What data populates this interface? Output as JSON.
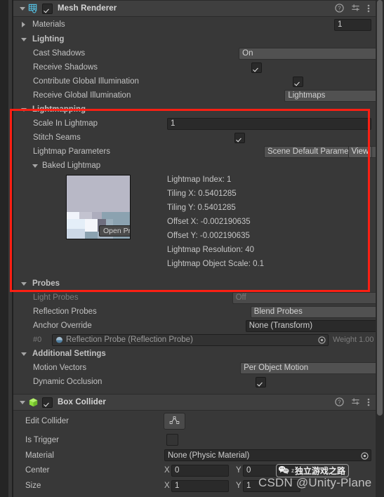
{
  "mesh_renderer": {
    "title": "Mesh Renderer",
    "enabled": true,
    "icon": "mesh-renderer-icon",
    "header_icons": [
      "help-icon",
      "preset-icon",
      "more-menu-icon"
    ],
    "materials": {
      "label": "Materials",
      "count": "1"
    },
    "lighting": {
      "label": "Lighting",
      "rows": [
        {
          "label": "Cast Shadows",
          "type": "dropdown",
          "value": "On"
        },
        {
          "label": "Receive Shadows",
          "type": "checkbox",
          "value": true
        },
        {
          "label": "Contribute Global Illumination",
          "type": "checkbox",
          "value": true
        },
        {
          "label": "Receive Global Illumination",
          "type": "dropdown",
          "value": "Lightmaps"
        }
      ]
    },
    "lightmapping": {
      "label": "Lightmapping",
      "scale_in_lightmap": {
        "label": "Scale In Lightmap",
        "value": "1"
      },
      "stitch_seams": {
        "label": "Stitch Seams",
        "value": true
      },
      "lightmap_parameters": {
        "label": "Lightmap Parameters",
        "value": "Scene Default Parameters",
        "button": "View"
      },
      "baked_lightmap": {
        "label": "Baked Lightmap",
        "preview_button": "Open Preview",
        "stats": [
          "Lightmap Index: 1",
          "Tiling X: 0.5401285",
          "Tiling Y: 0.5401285",
          "Offset X: -0.002190635",
          "Offset Y: -0.002190635",
          "Lightmap Resolution: 40",
          "Lightmap Object Scale: 0.1"
        ]
      }
    },
    "probes": {
      "label": "Probes",
      "light_probes": {
        "label": "Light Probes",
        "value": "Off",
        "disabled": true
      },
      "reflection_probes": {
        "label": "Reflection Probes",
        "value": "Blend Probes"
      },
      "anchor_override": {
        "label": "Anchor Override",
        "value": "None (Transform)"
      },
      "probe_entry": {
        "index": "#0",
        "name": "Reflection Probe (Reflection Probe)",
        "weight": "Weight 1.00"
      }
    },
    "additional_settings": {
      "label": "Additional Settings",
      "motion_vectors": {
        "label": "Motion Vectors",
        "value": "Per Object Motion"
      },
      "dynamic_occlusion": {
        "label": "Dynamic Occlusion",
        "value": true
      }
    }
  },
  "box_collider": {
    "title": "Box Collider",
    "enabled": true,
    "icon": "box-collider-icon",
    "edit_collider": {
      "label": "Edit Collider"
    },
    "is_trigger": {
      "label": "Is Trigger",
      "value": false
    },
    "material": {
      "label": "Material",
      "value": "None (Physic Material)"
    },
    "center": {
      "label": "Center",
      "x_label": "X",
      "x": "0",
      "y_label": "Y",
      "y": "0"
    },
    "size": {
      "label": "Size",
      "x_label": "X",
      "x": "1",
      "y_label": "Y",
      "y": "1"
    }
  },
  "watermark": {
    "badge_prefix": "z",
    "badge_text": "独立游戏之路",
    "csdn_text": "CSDN @Unity-Plane"
  },
  "annotation": {
    "highlight_color": "#fb1f13"
  },
  "theme": {
    "panel_bg": "#383838",
    "header_bg": "#3f3f3f",
    "field_bg": "#2a2a2a",
    "dropdown_bg": "#515151",
    "text": "#c2c2c2",
    "mesh_icon_color": "#56c5e8",
    "collider_icon_color": "#8ddc3c"
  }
}
